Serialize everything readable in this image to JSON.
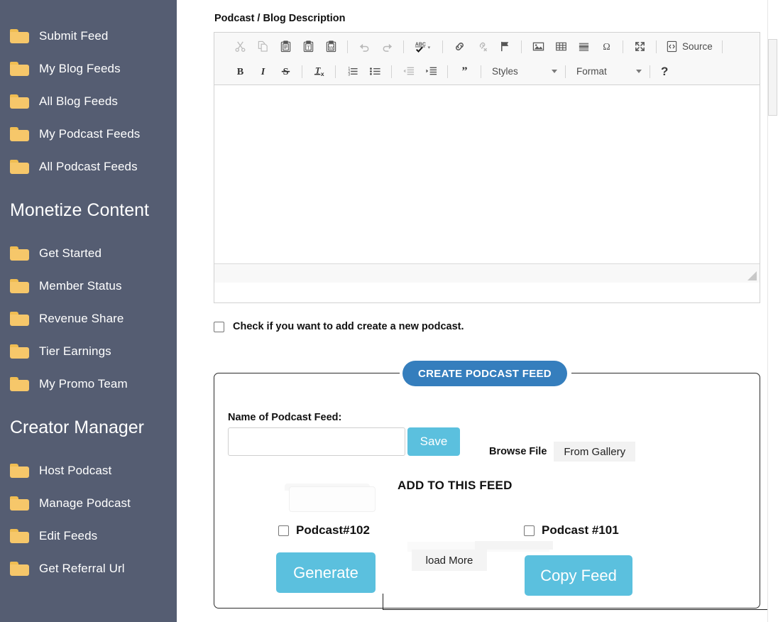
{
  "sidebar": {
    "background_color": "#555d72",
    "folder_icon_color": "#f6c76a",
    "groups": [
      {
        "heading": null,
        "items": [
          {
            "icon": "folder-icon",
            "label": "Submit Feed"
          },
          {
            "icon": "folder-icon",
            "label": "My Blog Feeds"
          },
          {
            "icon": "folder-icon",
            "label": "All Blog Feeds"
          },
          {
            "icon": "folder-icon",
            "label": "My Podcast Feeds"
          },
          {
            "icon": "folder-icon",
            "label": "All Podcast Feeds"
          }
        ]
      },
      {
        "heading": "Monetize Content",
        "items": [
          {
            "icon": "folder-icon",
            "label": "Get Started"
          },
          {
            "icon": "folder-icon",
            "label": "Member Status"
          },
          {
            "icon": "folder-icon",
            "label": "Revenue Share"
          },
          {
            "icon": "folder-icon",
            "label": "Tier Earnings"
          },
          {
            "icon": "folder-icon",
            "label": "My Promo Team"
          }
        ]
      },
      {
        "heading": "Creator Manager",
        "items": [
          {
            "icon": "folder-icon",
            "label": "Host Podcast"
          },
          {
            "icon": "folder-icon",
            "label": "Manage Podcast"
          },
          {
            "icon": "folder-icon",
            "label": "Edit Feeds"
          },
          {
            "icon": "folder-icon",
            "label": "Get Referral Url"
          }
        ]
      }
    ]
  },
  "main": {
    "section_title": "Podcast / Blog Description",
    "editor": {
      "body_value": "",
      "toolbar_row1": [
        {
          "icon": "cut-icon",
          "tooltip": "Cut",
          "enabled": false
        },
        {
          "icon": "copy-icon",
          "tooltip": "Copy",
          "enabled": false
        },
        {
          "icon": "paste-icon",
          "tooltip": "Paste",
          "enabled": true
        },
        {
          "icon": "paste-text-icon",
          "tooltip": "Paste as plain text",
          "enabled": true
        },
        {
          "icon": "paste-word-icon",
          "tooltip": "Paste from Word",
          "enabled": true
        },
        {
          "icon": "undo-icon",
          "tooltip": "Undo",
          "enabled": false
        },
        {
          "icon": "redo-icon",
          "tooltip": "Redo",
          "enabled": false
        },
        {
          "icon": "spellcheck-icon",
          "tooltip": "Spell Check As You Type",
          "enabled": true
        },
        {
          "icon": "link-icon",
          "tooltip": "Link",
          "enabled": true
        },
        {
          "icon": "unlink-icon",
          "tooltip": "Unlink",
          "enabled": false
        },
        {
          "icon": "anchor-flag-icon",
          "tooltip": "Anchor",
          "enabled": true
        },
        {
          "icon": "image-icon",
          "tooltip": "Image",
          "enabled": true
        },
        {
          "icon": "table-icon",
          "tooltip": "Table",
          "enabled": true
        },
        {
          "icon": "horizontal-rule-icon",
          "tooltip": "Horizontal Line",
          "enabled": true
        },
        {
          "icon": "special-char-icon",
          "tooltip": "Insert Special Character",
          "enabled": true
        },
        {
          "icon": "maximize-icon",
          "tooltip": "Maximize",
          "enabled": true
        }
      ],
      "source_label": "Source",
      "source_icon": "source-icon",
      "toolbar_row2": [
        {
          "icon": "bold-icon",
          "tooltip": "Bold",
          "enabled": true
        },
        {
          "icon": "italic-icon",
          "tooltip": "Italic",
          "enabled": true
        },
        {
          "icon": "strikethrough-icon",
          "tooltip": "Strikethrough",
          "enabled": true
        },
        {
          "icon": "remove-format-icon",
          "tooltip": "Remove Format",
          "enabled": true
        },
        {
          "icon": "numbered-list-icon",
          "tooltip": "Insert/Remove Numbered List",
          "enabled": true
        },
        {
          "icon": "bulleted-list-icon",
          "tooltip": "Insert/Remove Bulleted List",
          "enabled": true
        },
        {
          "icon": "outdent-icon",
          "tooltip": "Decrease Indent",
          "enabled": false
        },
        {
          "icon": "indent-icon",
          "tooltip": "Increase Indent",
          "enabled": true
        },
        {
          "icon": "blockquote-icon",
          "tooltip": "Block Quote",
          "enabled": true
        }
      ],
      "styles_label": "Styles",
      "format_label": "Format",
      "help_label": "?"
    },
    "new_podcast_checkbox": {
      "checked": false,
      "label": "Check if you want to add create a new podcast."
    },
    "panel": {
      "tab_label": "CREATE PODCAST FEED",
      "tab_color": "#357ebd",
      "feed_name_label": "Name of Podcast Feed:",
      "feed_name_value": "",
      "feed_name_placeholder": "",
      "save_label": "Save",
      "save_color": "#5bc0de",
      "browse_file_label": "Browse File",
      "from_gallery_label": "From Gallery",
      "add_to_feed_title": "ADD TO THIS FEED",
      "podcasts": [
        {
          "label": "Podcast#102",
          "checked": false
        },
        {
          "label": "Podcast #101",
          "checked": false
        }
      ],
      "generate_label": "Generate",
      "load_more_label": "load More",
      "copy_feed_label": "Copy Feed"
    }
  }
}
